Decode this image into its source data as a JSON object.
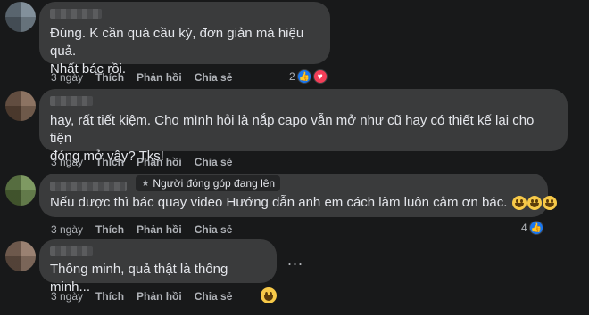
{
  "comments": [
    {
      "text_lines": [
        "Đúng. K cần quá cầu kỳ, đơn giản mà hiệu quả.",
        "Nhất bác rồi."
      ],
      "time": "3 ngày",
      "like": "Thích",
      "reply": "Phản hồi",
      "share": "Chia sẻ",
      "reaction_count": "2",
      "reaction_icons": [
        "like-icon",
        "love-icon"
      ]
    },
    {
      "text_lines": [
        "hay, rất tiết kiệm. Cho mình hỏi là nắp capo vẫn mở như cũ hay có thiết kế lại cho tiện",
        "đóng mở vậy? Tks!"
      ],
      "time": "3 ngày",
      "like": "Thích",
      "reply": "Phản hồi",
      "share": "Chia sẻ"
    },
    {
      "badge": "Người đóng góp đang lên",
      "text_lines": [
        "Nếu được thì bác quay video Hướng dẫn anh em cách làm luôn cảm ơn bác."
      ],
      "time": "3 ngày",
      "like": "Thích",
      "reply": "Phản hồi",
      "share": "Chia sẻ",
      "reaction_count": "4",
      "reaction_icons": [
        "like-icon"
      ]
    },
    {
      "text_lines": [
        "Thông minh, quả thật là thông minh..."
      ],
      "time": "3 ngày",
      "like": "Thích",
      "reply": "Phản hồi",
      "share": "Chia sẻ",
      "more": "...",
      "reaction_icons": [
        "grin-emoji-icon"
      ]
    }
  ]
}
